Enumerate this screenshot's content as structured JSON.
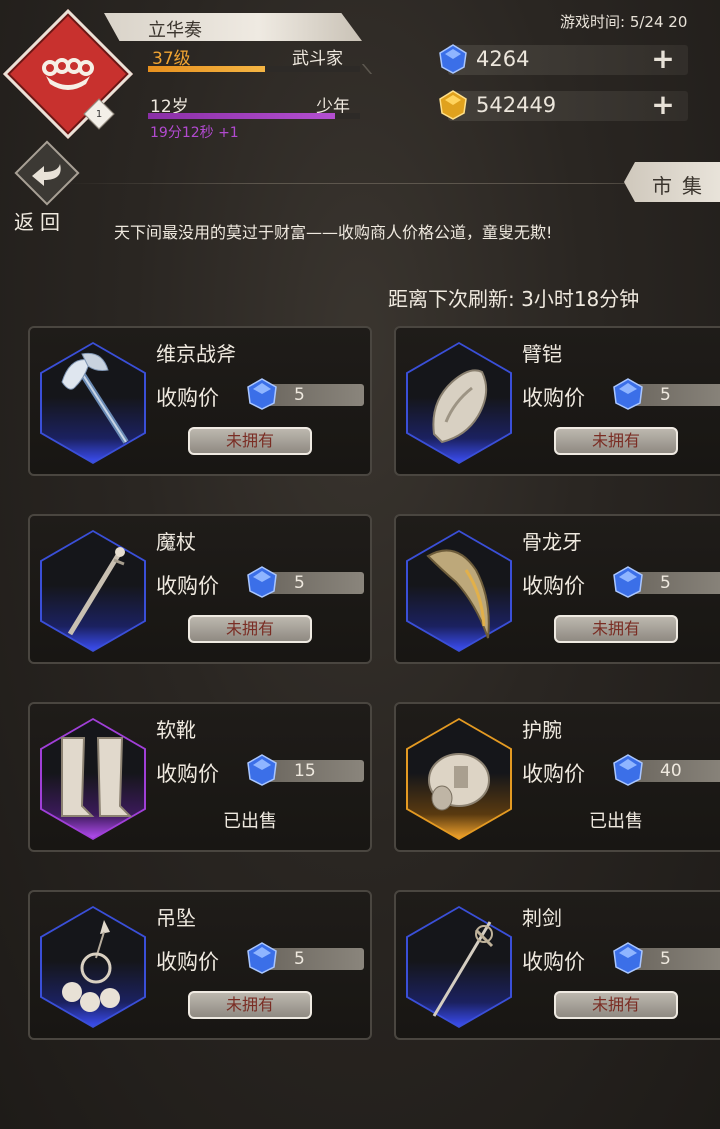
{
  "player": {
    "name": "立华奏",
    "level": "37级",
    "class": "武斗家",
    "age": "12岁",
    "stage": "少年",
    "timer": "19分12秒 +1",
    "rank_badge": "1",
    "xp_progress": 0.55,
    "age_progress": 0.88
  },
  "game_time": "游戏时间: 5/24 20",
  "currency": {
    "diamond": "4264",
    "gold": "542449"
  },
  "nav": {
    "back_label": "返回",
    "market_label": "市集"
  },
  "merchant": {
    "description": "天下间最没用的莫过于财富——收购商人价格公道，童叟无欺!",
    "refresh": "距离下次刷新: 3小时18分钟"
  },
  "price_label": "收购价",
  "items": [
    {
      "name": "维京战斧",
      "price": "5",
      "status": "未拥有",
      "rarity": "blue",
      "icon": "battle-axe-icon"
    },
    {
      "name": "臂铠",
      "price": "5",
      "status": "未拥有",
      "rarity": "blue",
      "icon": "arm-guard-icon"
    },
    {
      "name": "魔杖",
      "price": "5",
      "status": "未拥有",
      "rarity": "blue",
      "icon": "wand-icon"
    },
    {
      "name": "骨龙牙",
      "price": "5",
      "status": "未拥有",
      "rarity": "blue",
      "icon": "dragon-fang-icon"
    },
    {
      "name": "软靴",
      "price": "15",
      "status": "已出售",
      "rarity": "purple",
      "icon": "boots-icon"
    },
    {
      "name": "护腕",
      "price": "40",
      "status": "已出售",
      "rarity": "gold",
      "icon": "bracer-icon"
    },
    {
      "name": "吊坠",
      "price": "5",
      "status": "未拥有",
      "rarity": "blue",
      "icon": "pendant-icon"
    },
    {
      "name": "刺剑",
      "price": "5",
      "status": "未拥有",
      "rarity": "blue",
      "icon": "rapier-icon"
    }
  ],
  "colors": {
    "level": "#f0a432",
    "timer": "#b24ad0",
    "rarity_blue": "#3a4fd8",
    "rarity_purple": "#a03fd8",
    "rarity_gold": "#e49a22"
  }
}
